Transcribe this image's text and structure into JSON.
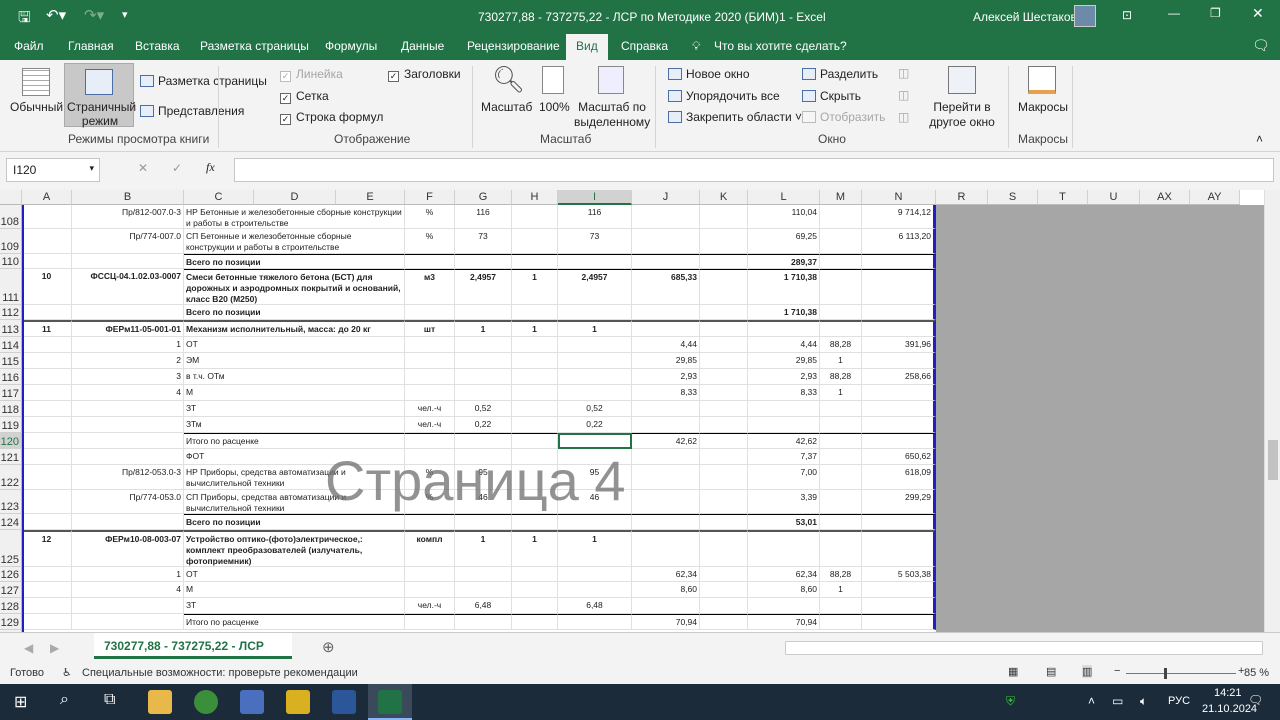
{
  "title": "730277,88 -  737275,22  - ЛСР по Методике 2020 (БИМ)1  -  Excel",
  "user": "Алексей Шестаков",
  "tabs": [
    "Файл",
    "Главная",
    "Вставка",
    "Разметка страницы",
    "Формулы",
    "Данные",
    "Рецензирование",
    "Вид",
    "Справка"
  ],
  "tell_me": "Что вы хотите сделать?",
  "ribbon": {
    "normal": "Обычный",
    "page_break": "Страничный режим",
    "page_layout": "Разметка страницы",
    "views": "Представления",
    "views_group": "Режимы просмотра книги",
    "ruler": "Линейка",
    "headings": "Заголовки",
    "grid": "Сетка",
    "formula_bar": "Строка формул",
    "show_group": "Отображение",
    "zoom": "Масштаб",
    "zoom100": "100%",
    "zoom_sel": "Масштаб по выделенному",
    "zoom_group": "Масштаб",
    "new_window": "Новое окно",
    "arrange": "Упорядочить все",
    "freeze": "Закрепить области",
    "split": "Разделить",
    "hide": "Скрыть",
    "unhide": "Отобразить",
    "switch": "Перейти в другое окно",
    "window_group": "Окно",
    "macros": "Макросы",
    "macros_group": "Макросы"
  },
  "name_box": "I120",
  "fx": "fx",
  "columns": [
    "A",
    "B",
    "C",
    "D",
    "E",
    "F",
    "G",
    "H",
    "I",
    "J",
    "K",
    "L",
    "M",
    "N",
    "R",
    "S",
    "T",
    "U",
    "AX",
    "AY"
  ],
  "rows": [
    {
      "n": "108",
      "B": "Пр/812-007.0-3",
      "C": "НР Бетонные и железобетонные сборные конструкции и работы в строительстве",
      "F": "%",
      "G": "116",
      "I": "116",
      "L": "110,04",
      "N": "9 714,12"
    },
    {
      "n": "109",
      "B": "Пр/774-007.0",
      "C": "СП Бетонные и железобетонные сборные конструкции и работы в строительстве",
      "F": "%",
      "G": "73",
      "I": "73",
      "L": "69,25",
      "N": "6 113,20"
    },
    {
      "n": "110",
      "C": "Всего по позиции",
      "L": "289,37",
      "bold": true
    },
    {
      "n": "111",
      "A": "10",
      "B": "ФССЦ-04.1.02.03-0007",
      "C": "Смеси бетонные тяжелого бетона (БСТ) для дорожных и аэродромных покрытий и оснований, класс В20 (М250)",
      "F": "м3",
      "G": "2,4957",
      "H": "1",
      "I": "2,4957",
      "J": "685,33",
      "L": "1 710,38",
      "bold": true
    },
    {
      "n": "112",
      "C": "Всего по позиции",
      "L": "1 710,38",
      "bold": true
    },
    {
      "n": "113",
      "A": "11",
      "B": "ФЕРм11-05-001-01",
      "C": "Механизм исполнительный, масса: до 20 кг",
      "F": "шт",
      "G": "1",
      "H": "1",
      "I": "1",
      "bold": true
    },
    {
      "n": "114",
      "B": "1",
      "C": "ОТ",
      "J": "4,44",
      "L": "4,44",
      "M": "88,28",
      "N": "391,96"
    },
    {
      "n": "115",
      "B": "2",
      "C": "ЭМ",
      "J": "29,85",
      "L": "29,85",
      "M": "1"
    },
    {
      "n": "116",
      "B": "3",
      "C": "в т.ч. ОТм",
      "J": "2,93",
      "L": "2,93",
      "M": "88,28",
      "N": "258,66"
    },
    {
      "n": "117",
      "B": "4",
      "C": "М",
      "J": "8,33",
      "L": "8,33",
      "M": "1"
    },
    {
      "n": "118",
      "C": "ЗТ",
      "F": "чел.-ч",
      "G": "0,52",
      "I": "0,52"
    },
    {
      "n": "119",
      "C": "ЗТм",
      "F": "чел.-ч",
      "G": "0,22",
      "I": "0,22"
    },
    {
      "n": "120",
      "C": "Итого по расценке",
      "J": "42,62",
      "L": "42,62"
    },
    {
      "n": "121",
      "C": "ФОТ",
      "L": "7,37",
      "N": "650,62"
    },
    {
      "n": "122",
      "B": "Пр/812-053.0-3",
      "C": "НР Приборы, средства автоматизации и вычислительной техники",
      "F": "%",
      "G": "95",
      "I": "95",
      "L": "7,00",
      "N": "618,09"
    },
    {
      "n": "123",
      "B": "Пр/774-053.0",
      "C": "СП Приборы, средства автоматизации и вычислительной техники",
      "F": "%",
      "G": "46",
      "I": "46",
      "L": "3,39",
      "N": "299,29"
    },
    {
      "n": "124",
      "C": "Всего по позиции",
      "L": "53,01",
      "bold": true
    },
    {
      "n": "125",
      "A": "12",
      "B": "ФЕРм10-08-003-07",
      "C": "Устройство оптико-(фото)электрическое,: комплект преобразователей (излучатель, фотоприемник)",
      "F": "компл",
      "G": "1",
      "H": "1",
      "I": "1",
      "bold": true
    },
    {
      "n": "126",
      "B": "1",
      "C": "ОТ",
      "J": "62,34",
      "L": "62,34",
      "M": "88,28",
      "N": "5 503,38"
    },
    {
      "n": "127",
      "B": "4",
      "C": "М",
      "J": "8,60",
      "L": "8,60",
      "M": "1"
    },
    {
      "n": "128",
      "C": "ЗТ",
      "F": "чел.-ч",
      "G": "6,48",
      "I": "6,48"
    },
    {
      "n": "129",
      "C": "Итого по расценке",
      "J": "70,94",
      "L": "70,94"
    }
  ],
  "watermark": "Страница 4",
  "sheet_tab": "730277,88 -  737275,22  - ЛСР",
  "status": {
    "ready": "Готово",
    "accessibility": "Специальные возможности: проверьте рекомендации",
    "zoom": "85 %"
  },
  "taskbar": {
    "lang": "РУС",
    "time": "14:21",
    "date": "21.10.2024"
  }
}
